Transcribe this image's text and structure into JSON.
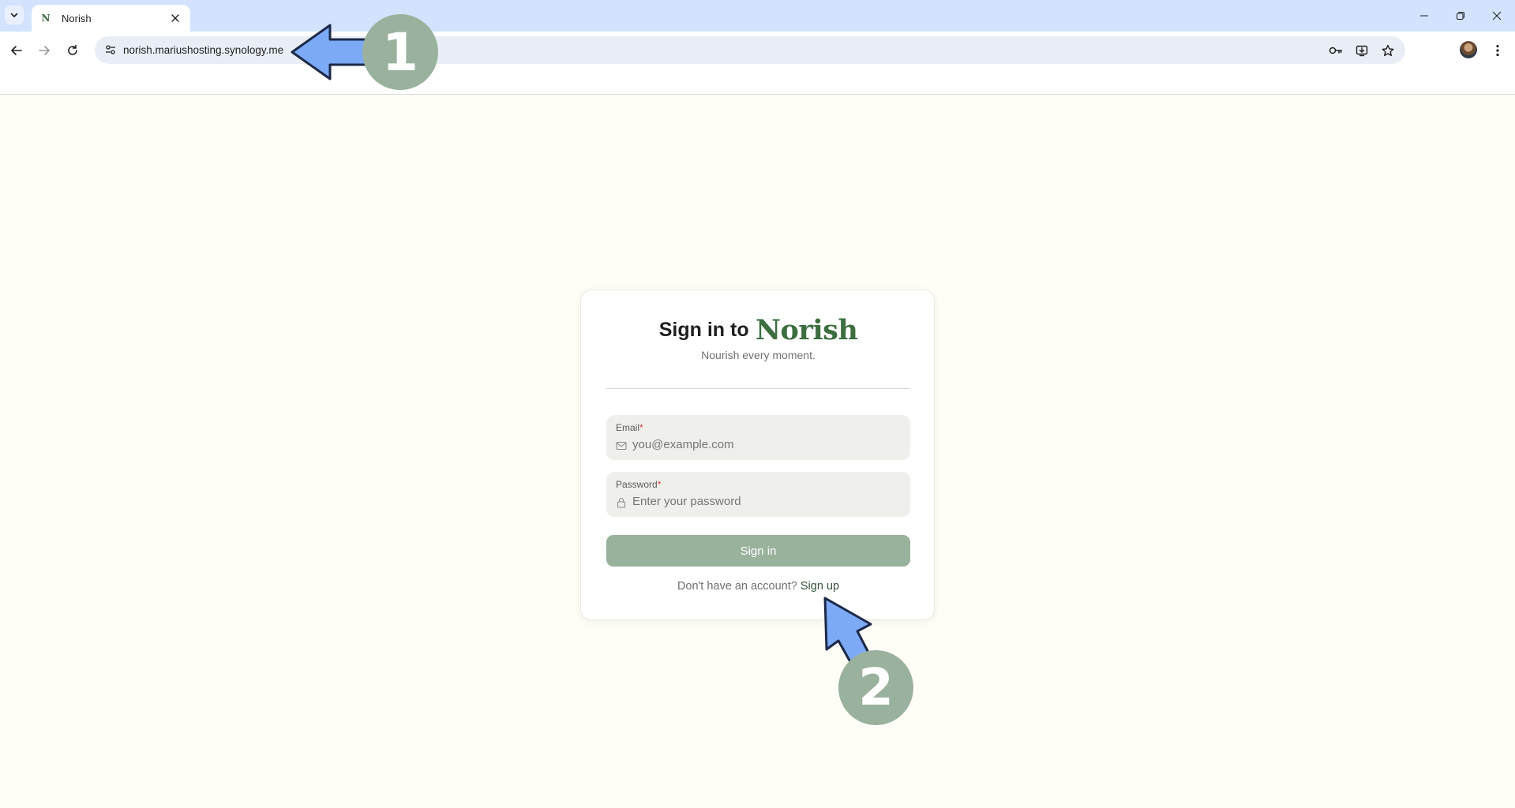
{
  "browser": {
    "tab_title": "Norish",
    "tab_favicon": "N",
    "url": "norish.mariushosting.synology.me",
    "icons": {
      "tab_list": "chevron-down-icon",
      "close": "close-icon",
      "minimize": "minimize-icon",
      "restore": "restore-icon",
      "close_window": "close-window-icon",
      "back": "back-arrow-icon",
      "forward": "forward-arrow-icon",
      "reload": "reload-icon",
      "site_info": "tune-icon",
      "password": "key-icon",
      "install": "install-app-icon",
      "bookmark": "star-icon",
      "menu": "more-vert-icon"
    }
  },
  "signin": {
    "heading": "Sign in to",
    "brand": "Norish",
    "tagline": "Nourish every moment.",
    "email": {
      "label": "Email",
      "required_marker": "*",
      "placeholder": "you@example.com",
      "value": "",
      "icon": "mail-icon"
    },
    "password": {
      "label": "Password",
      "required_marker": "*",
      "placeholder": "Enter your password",
      "value": "",
      "icon": "lock-icon"
    },
    "submit_label": "Sign in",
    "no_account_text": "Don't have an account?",
    "signup_link": "Sign up"
  },
  "annotations": {
    "step_1": "1",
    "step_2": "2"
  },
  "colors": {
    "page_bg": "#fefef6",
    "brand_green": "#3c6e3f",
    "button_green": "#99b29b",
    "badge_green": "#9ab29d",
    "arrow_blue": "#7daaf7",
    "tabstrip": "#d3e3fd"
  }
}
